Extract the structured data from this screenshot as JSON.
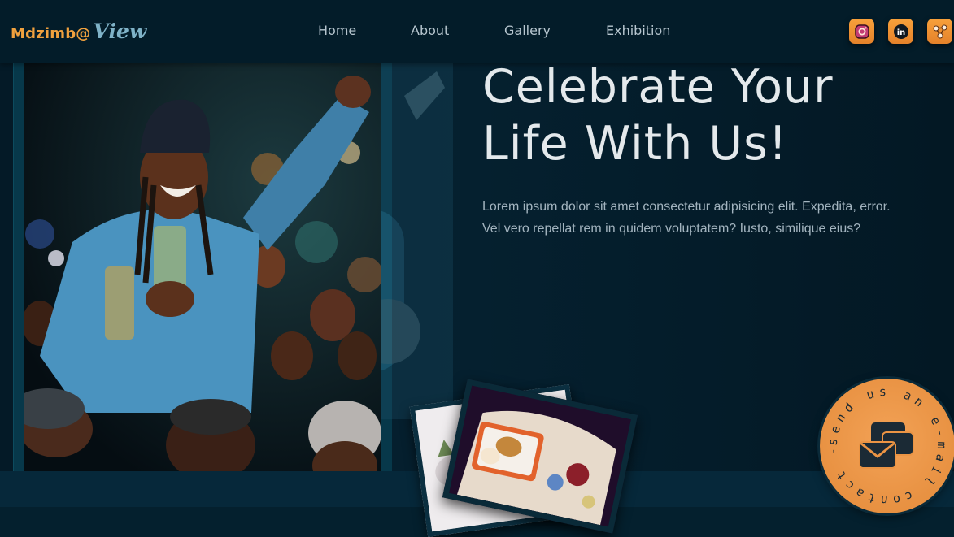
{
  "header": {
    "brand_text": "Mdzimb@",
    "brand_view": "View",
    "nav": [
      {
        "label": "Home"
      },
      {
        "label": "About"
      },
      {
        "label": "Gallery"
      },
      {
        "label": "Exhibition"
      }
    ],
    "social_icons": [
      "instagram-icon",
      "linkedin-icon",
      "share-icon"
    ],
    "accent_color": "#f0a13e"
  },
  "hero": {
    "title_line1": "Celebrate Your",
    "title_line2": "Life With Us!",
    "body": "Lorem ipsum dolor sit amet consectetur adipisicing elit. Expedita, error. Vel vero repellat rem in quidem voluptatem? Iusto, similique eius?"
  },
  "contact": {
    "ring_text": "send us an e-mail contact - ",
    "icon": "envelope-icon"
  }
}
